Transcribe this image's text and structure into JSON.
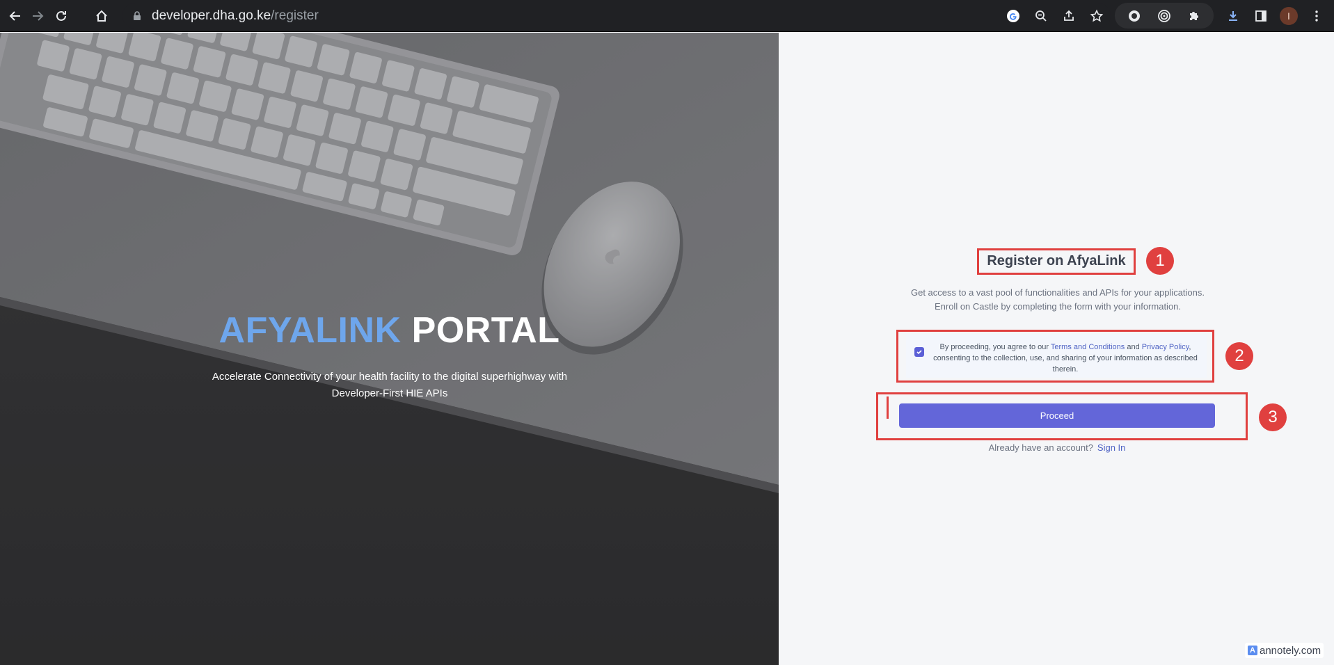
{
  "browser": {
    "url_host": "developer.dha.go.ke",
    "url_path": "/register",
    "profile_initial": "I"
  },
  "hero": {
    "title_accent": "AFYALINK",
    "title_main": " PORTAL",
    "subtitle": "Accelerate Connectivity of your health facility to the digital superhighway with Developer-First HIE APIs"
  },
  "form": {
    "title": "Register on AfyaLink",
    "description_line1": "Get access to a vast pool of functionalities and APIs for your applications.",
    "description_line2": "Enroll on Castle by completing the form with your information.",
    "agreement": {
      "checked": true,
      "prefix": "By proceeding, you agree to our ",
      "terms_link": "Terms and Conditions",
      "and": " and ",
      "privacy_link": "Privacy Policy",
      "suffix": ", consenting to the collection, use, and sharing of your information as described therein."
    },
    "proceed_label": "Proceed",
    "signin_prompt": "Already have an account?",
    "signin_link": "Sign In"
  },
  "annotations": [
    {
      "number": "1"
    },
    {
      "number": "2"
    },
    {
      "number": "3"
    }
  ],
  "watermark": "annotely.com",
  "colors": {
    "accent": "#6366d9",
    "annotation": "#e0403f",
    "hero_accent": "#6ea6ec",
    "link": "#4f63c4"
  }
}
